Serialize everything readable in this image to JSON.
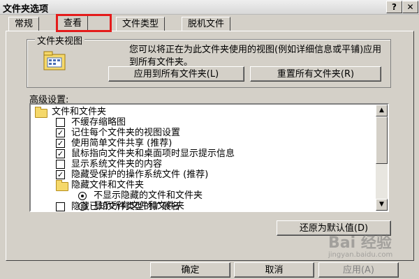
{
  "window": {
    "title": "文件夹选项",
    "help_button": "?",
    "close_button": "✕"
  },
  "tabs": [
    {
      "label": "常规",
      "active": false
    },
    {
      "label": "查看",
      "active": true
    },
    {
      "label": "文件类型",
      "active": false
    },
    {
      "label": "脱机文件",
      "active": false
    }
  ],
  "folder_views": {
    "group_label": "文件夹视图",
    "description": "您可以将正在为此文件夹使用的视图(例如详细信息或平铺)应用到所有文件夹。",
    "apply_all_button": "应用到所有文件夹(L)",
    "reset_all_button": "重置所有文件夹(R)"
  },
  "advanced": {
    "label": "高级设置:",
    "items": [
      {
        "type": "folder",
        "label": "文件和文件夹",
        "indent": 0
      },
      {
        "type": "checkbox",
        "label": "不缓存缩略图",
        "checked": false,
        "indent": 1
      },
      {
        "type": "checkbox",
        "label": "记住每个文件夹的视图设置",
        "checked": true,
        "indent": 1
      },
      {
        "type": "checkbox",
        "label": "使用简单文件共享 (推荐)",
        "checked": true,
        "indent": 1
      },
      {
        "type": "checkbox",
        "label": "鼠标指向文件夹和桌面项时显示提示信息",
        "checked": true,
        "indent": 1
      },
      {
        "type": "checkbox",
        "label": "显示系统文件夹的内容",
        "checked": false,
        "indent": 1
      },
      {
        "type": "checkbox",
        "label": "隐藏受保护的操作系统文件 (推荐)",
        "checked": true,
        "indent": 1
      },
      {
        "type": "folder",
        "label": "隐藏文件和文件夹",
        "indent": 1
      },
      {
        "type": "radio",
        "label": "不显示隐藏的文件和文件夹",
        "checked": true,
        "indent": 2
      },
      {
        "type": "radio",
        "label": "显示所有文件和文件夹",
        "checked": false,
        "indent": 2
      },
      {
        "type": "checkbox",
        "label": "隐藏已知文件类型的扩展名",
        "checked": false,
        "indent": 1
      }
    ],
    "restore_defaults_button": "还原为默认值(D)"
  },
  "footer": {
    "ok_button": "确定",
    "cancel_button": "取消",
    "apply_button": "应用(A)"
  },
  "watermark": {
    "text": "Bai 经验",
    "url": "jingyan.baidu.com"
  }
}
